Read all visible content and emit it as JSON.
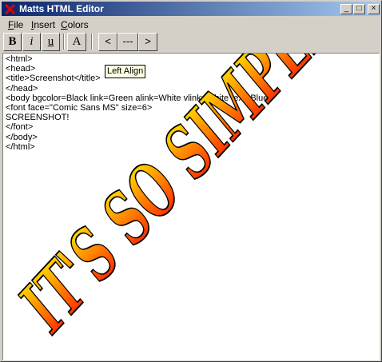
{
  "window": {
    "title": "Matts HTML Editor"
  },
  "title_buttons": {
    "minimize": "_",
    "maximize": "□",
    "close": "×"
  },
  "menu": [
    {
      "label": "File",
      "underline": "F",
      "rest": "ile"
    },
    {
      "label": "Insert",
      "underline": "I",
      "rest": "nsert"
    },
    {
      "label": "Colors",
      "underline": "C",
      "rest": "olors"
    }
  ],
  "toolbar": {
    "bold": "B",
    "italic": "i",
    "underline": "u",
    "font": "A",
    "align_left": "<",
    "align_center": "---",
    "align_right": ">"
  },
  "tooltip": "Left Align",
  "editor": {
    "lines": [
      "<html>",
      "<head>",
      "<title>Screenshot</title>",
      "</head>",
      "<body bgcolor=Black link=Green alink=White vlink=White text=Blue>",
      "<font face=\"Comic Sans MS\" size=6>",
      "SCREENSHOT!",
      "</font>",
      "</body>",
      "</html>"
    ]
  },
  "art": {
    "text": "IT'S SO SIMPLE!!!",
    "colors": [
      "#ffff00",
      "#ff0000"
    ]
  }
}
